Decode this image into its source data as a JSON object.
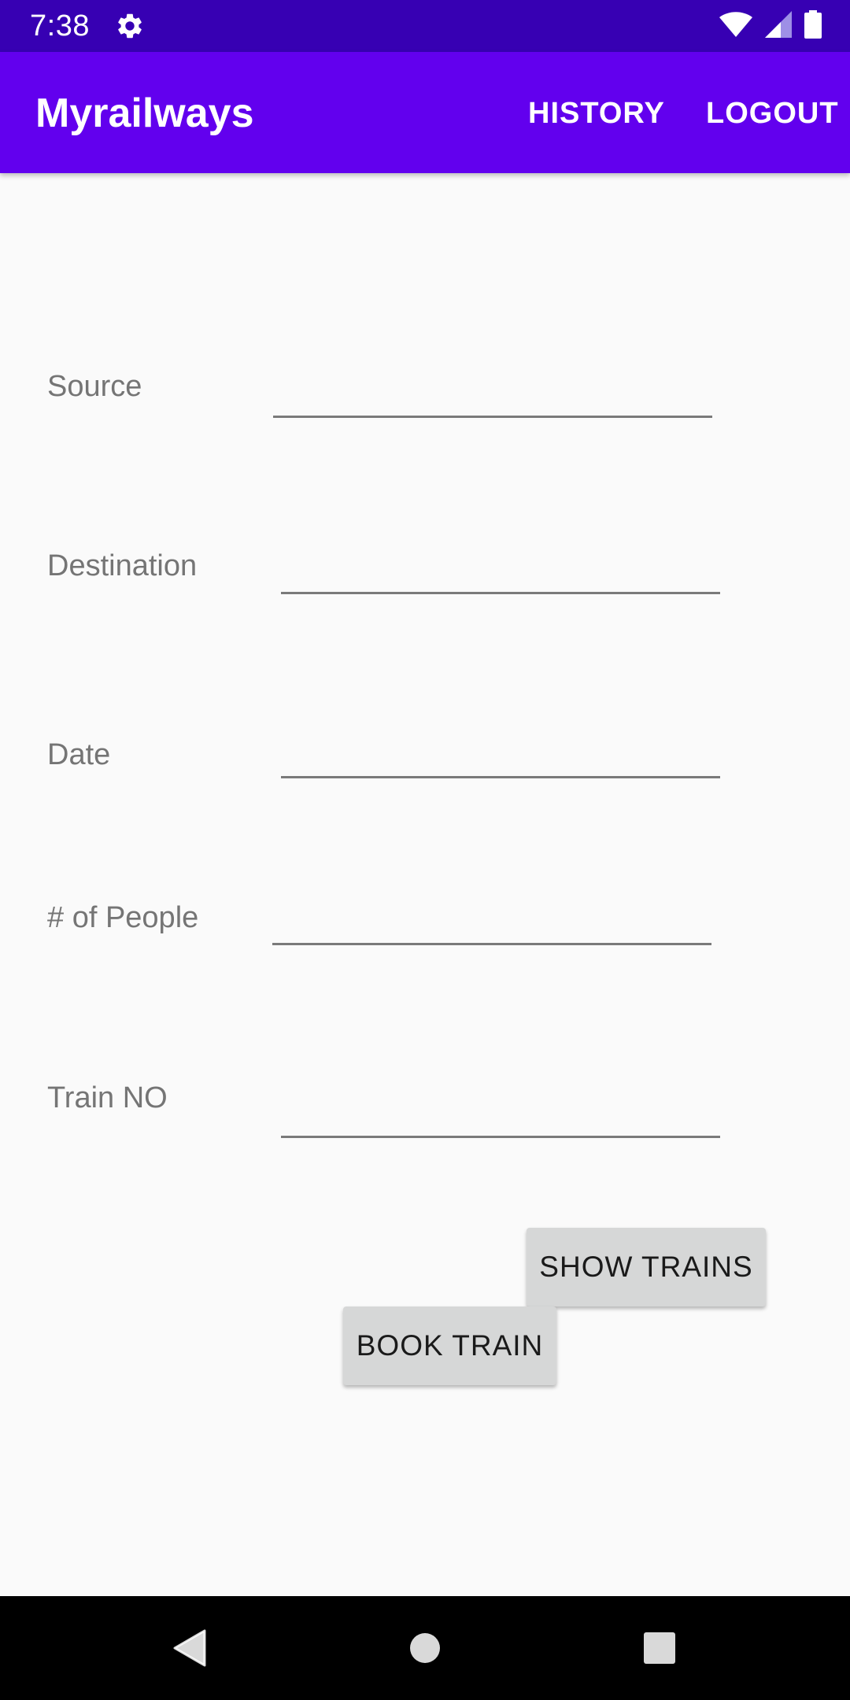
{
  "status_bar": {
    "time": "7:38",
    "icons": [
      "gear-icon",
      "wifi-icon",
      "signal-icon",
      "battery-icon"
    ]
  },
  "app_bar": {
    "title": "Myrailways",
    "menu": {
      "history": "HISTORY",
      "logout": "LOGOUT"
    },
    "color": "#6200ee"
  },
  "form": {
    "source": {
      "label": "Source",
      "value": ""
    },
    "destination": {
      "label": "Destination",
      "value": ""
    },
    "date": {
      "label": "Date",
      "value": ""
    },
    "people": {
      "label": "# of People",
      "value": ""
    },
    "train_no": {
      "label": "Train NO",
      "value": ""
    }
  },
  "buttons": {
    "show_trains": "SHOW TRAINS",
    "book_train": "BOOK TRAIN"
  },
  "nav_bar": {
    "icons": [
      "back-icon",
      "home-icon",
      "recents-icon"
    ]
  },
  "colors": {
    "status_bar": "#3700b3",
    "app_bar": "#6200ee",
    "background": "#fafafa",
    "button": "#d6d7d7"
  }
}
